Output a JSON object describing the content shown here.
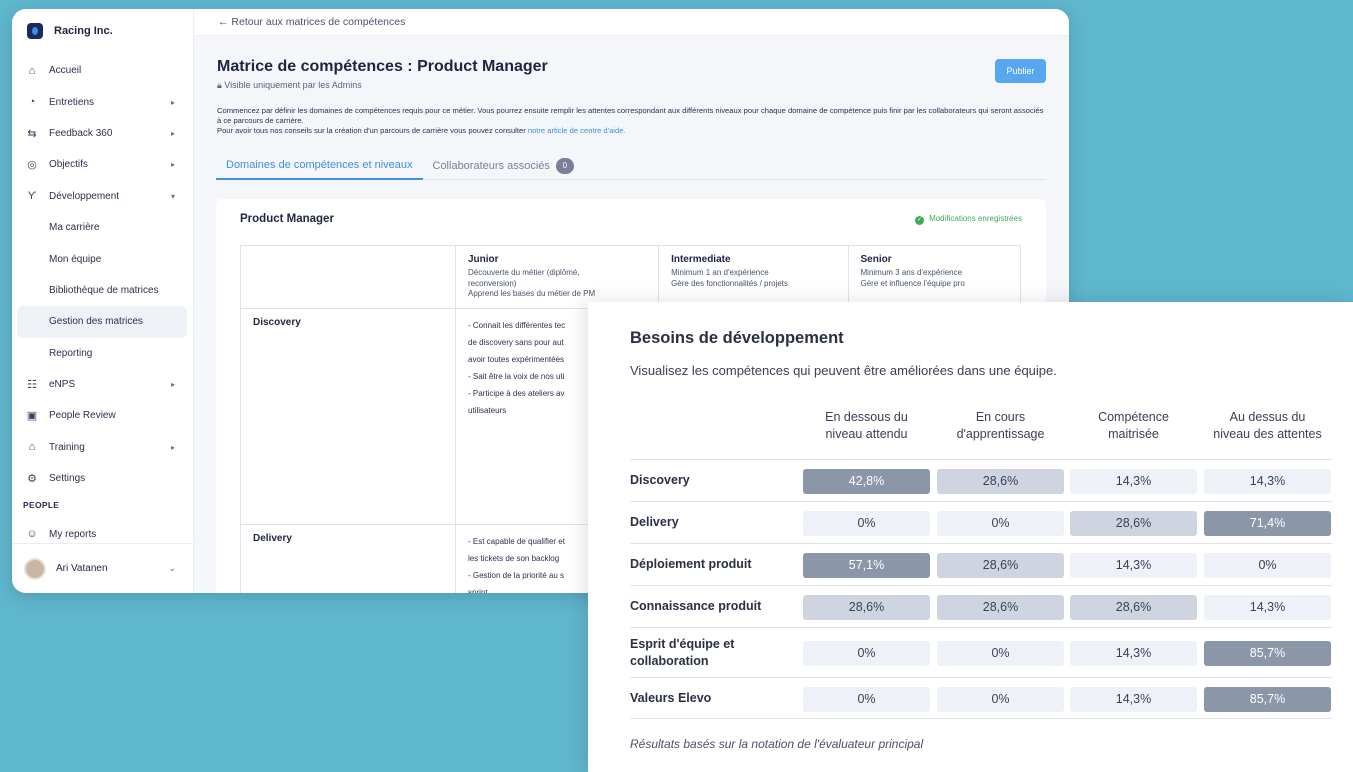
{
  "app": {
    "brand": "Racing Inc."
  },
  "sidebar": {
    "items": [
      {
        "label": "Accueil",
        "icon": "home-icon",
        "glyph": "⌂",
        "chev": false,
        "sub": false
      },
      {
        "label": "Entretiens",
        "icon": "chat-icon",
        "glyph": "◔",
        "chev": true,
        "sub": false
      },
      {
        "label": "Feedback 360",
        "icon": "feedback-icon",
        "glyph": "⇆",
        "chev": true,
        "sub": false
      },
      {
        "label": "Objectifs",
        "icon": "target-icon",
        "glyph": "◎",
        "chev": true,
        "sub": false
      },
      {
        "label": "Développement",
        "icon": "sprout-icon",
        "glyph": "ϒ",
        "chev": true,
        "sub": false,
        "open": true
      },
      {
        "label": "Ma carrière",
        "sub": true
      },
      {
        "label": "Mon équipe",
        "sub": true
      },
      {
        "label": "Bibliothèque de matrices",
        "sub": true
      },
      {
        "label": "Gestion des matrices",
        "sub": true,
        "active": true
      },
      {
        "label": "Reporting",
        "sub": true
      },
      {
        "label": "eNPS",
        "icon": "enps-icon",
        "glyph": "☷",
        "chev": true,
        "sub": false
      },
      {
        "label": "People Review",
        "icon": "review-icon",
        "glyph": "▣",
        "chev": false,
        "sub": false
      },
      {
        "label": "Training",
        "icon": "graduation-icon",
        "glyph": "⌂",
        "chev": true,
        "sub": false
      },
      {
        "label": "Settings",
        "icon": "gear-icon",
        "glyph": "⚙",
        "chev": false,
        "sub": false
      }
    ],
    "section_people": "PEOPLE",
    "my_reports": "My reports",
    "user_name": "Ari Vatanen"
  },
  "main": {
    "back_link": "← Retour aux matrices de compétences",
    "title": "Matrice de compétences : Product Manager",
    "visibility": "Visible uniquement par les Admins",
    "publish": "Publier",
    "intro1": "Commencez par définir les domaines de compétences requis pour ce métier. Vous pourrez ensuite remplir les attentes correspondant aux différents niveaux pour chaque domaine de compétence puis finir par les collaborateurs qui seront associés à ce parcours de carrière.",
    "intro2": "Pour avoir tous nos conseils sur la création d'un parcours de carrière vous pouvez consulter ",
    "intro_link": "notre article de centre d'aide.",
    "tab1": "Domaines de compétences et niveaux",
    "tab2": "Collaborateurs associés",
    "tab2_count": "0",
    "card_title": "Product Manager",
    "saved": "Modifications enregistrées",
    "levels": [
      {
        "name": "Junior",
        "desc": [
          "Découverte du métier (diplômé,",
          "reconversion)",
          "Apprend les bases du métier de PM"
        ]
      },
      {
        "name": "Intermediate",
        "desc": [
          "Minimum 1 an d'expérience",
          "Gère des fonctionnalités / projets"
        ]
      },
      {
        "name": "Senior",
        "desc": [
          "Minimum 3 ans d'expérience",
          "Gère et influence l'équipe pro"
        ]
      }
    ],
    "rows": [
      {
        "domain": "Discovery",
        "junior": [
          "- Connait les différentes tec",
          "de discovery sans pour aut",
          "avoir toutes expérimentées",
          "- Sait être la voix de nos uti",
          "- Participe à des ateliers av",
          "utilisateurs"
        ]
      },
      {
        "domain": "Delivery",
        "junior": [
          "- Est capable de qualifier et",
          "les tickets de son backlog",
          "- Gestion de la priorité au s",
          "sprint"
        ]
      }
    ]
  },
  "dev_needs": {
    "title": "Besoins de développement",
    "subtitle": "Visualisez les compétences qui peuvent être améliorées dans une équipe.",
    "columns": [
      [
        "En dessous du",
        "niveau attendu"
      ],
      [
        "En cours",
        "d'apprentissage"
      ],
      [
        "Compétence",
        "maitrisée"
      ],
      [
        "Au dessus du",
        "niveau des attentes"
      ]
    ],
    "rows": [
      {
        "label": "Discovery",
        "values": [
          "42,8%",
          "28,6%",
          "14,3%",
          "14,3%"
        ],
        "levels": [
          3,
          2,
          1,
          1
        ]
      },
      {
        "label": "Delivery",
        "values": [
          "0%",
          "0%",
          "28,6%",
          "71,4%"
        ],
        "levels": [
          1,
          1,
          2,
          3
        ]
      },
      {
        "label": "Déploiement produit",
        "values": [
          "57,1%",
          "28,6%",
          "14,3%",
          "0%"
        ],
        "levels": [
          3,
          2,
          1,
          1
        ]
      },
      {
        "label": "Connaissance produit",
        "values": [
          "28,6%",
          "28,6%",
          "28,6%",
          "14,3%"
        ],
        "levels": [
          2,
          2,
          2,
          1
        ]
      },
      {
        "label": "Esprit d'équipe et collaboration",
        "values": [
          "0%",
          "0%",
          "14,3%",
          "85,7%"
        ],
        "levels": [
          1,
          1,
          1,
          3
        ]
      },
      {
        "label": "Valeurs Elevo",
        "values": [
          "0%",
          "0%",
          "14,3%",
          "85,7%"
        ],
        "levels": [
          1,
          1,
          1,
          3
        ]
      }
    ],
    "footnote": "Résultats basés sur la notation de l'évaluateur principal",
    "colors": {
      "level1": "#eef2f8",
      "level2": "#cfd5e0",
      "level3": "#8c96a9"
    }
  }
}
